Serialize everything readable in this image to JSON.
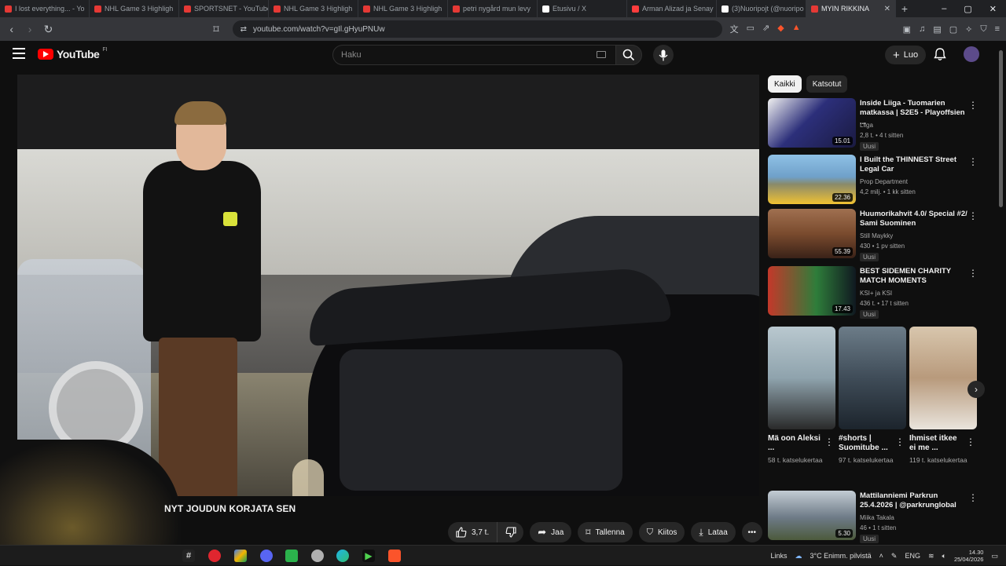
{
  "browser": {
    "tabs": [
      {
        "title": "I lost everything... - Yo"
      },
      {
        "title": "NHL Game 3 Highligh"
      },
      {
        "title": "SPORTSNET - YouTube"
      },
      {
        "title": "NHL Game 3 Highligh"
      },
      {
        "title": "NHL Game 3 Highligh"
      },
      {
        "title": "petri nygård mun levy"
      },
      {
        "title": "Etusivu / X"
      },
      {
        "title": "Arman Alizad ja Senay"
      },
      {
        "title": "(3)Nuoripojt (@nuoripo"
      },
      {
        "title": "MYIN RIKKINA"
      }
    ],
    "url": "youtube.com/watch?v=gIl.gHyuPNUw",
    "window_controls": [
      "–",
      "▢",
      "✕"
    ]
  },
  "header": {
    "logo_text": "YouTube",
    "country_code": "FI",
    "search_placeholder": "Haku",
    "create_label": "Luo"
  },
  "video": {
    "title": "NYT JOUDUN KORJATA SEN",
    "actions": {
      "like_count": "3,7 t.",
      "share_label": "Jaa",
      "save_label": "Tallenna",
      "thanks_label": "Kiitos",
      "download_label": "Lataa"
    }
  },
  "sidebar": {
    "chips": [
      "Kaikki",
      "Katsotut"
    ],
    "recommendations": [
      {
        "title": "Inside Liiga - Tuomarien matkassa | S2E5 - Playoffsien ...",
        "channel": "Liiga",
        "meta": "2,8 t. • 4 t sitten",
        "badge": "Uusi",
        "duration": "15.01",
        "thumb_color": "#2c2f7a"
      },
      {
        "title": "I Built the THINNEST Street Legal Car",
        "channel": "Prop Department",
        "meta": "4,2 milj. • 1 kk sitten",
        "badge": "",
        "duration": "22.36",
        "thumb_color": "#6fa0c9"
      },
      {
        "title": "Huumorikahvit 4.0/ Special #2/ Sami Suominen",
        "channel": "Still Maykky",
        "meta": "430 • 1 pv sitten",
        "badge": "Uusi",
        "duration": "55.39",
        "thumb_color": "#7a4b2e"
      },
      {
        "title": "BEST SIDEMEN CHARITY MATCH MOMENTS",
        "channel": "KSI+ ja KSI",
        "meta": "436 t. • 17 t sitten",
        "badge": "Uusi",
        "duration": "17.43",
        "thumb_color": "#2e7d3a"
      },
      {
        "title": "Mattilanniemi Parkrun 25.4.2026 | @parkrunglobal",
        "channel": "Miika Takala",
        "meta": "46 • 1 t sitten",
        "badge": "Uusi",
        "duration": "5.30",
        "thumb_color": "#6d7a86"
      }
    ],
    "shorts": [
      {
        "title": "Mä oon Aleksi ...",
        "views": "58 t. katselukertaa",
        "thumb_color": "#8fa3ad"
      },
      {
        "title": "#shorts | Suomitube ...",
        "views": "97 t. katselukertaa",
        "thumb_color": "#3f4c58"
      },
      {
        "title": "Ihmiset itkee ei me ...",
        "views": "119 t. katselukertaa",
        "thumb_color": "#b89a7c"
      }
    ]
  },
  "taskbar": {
    "links_label": "Links",
    "weather": "3°C Enimm. pilvistä",
    "language": "ENG",
    "time": "14.30",
    "date": "25/04/2026"
  }
}
